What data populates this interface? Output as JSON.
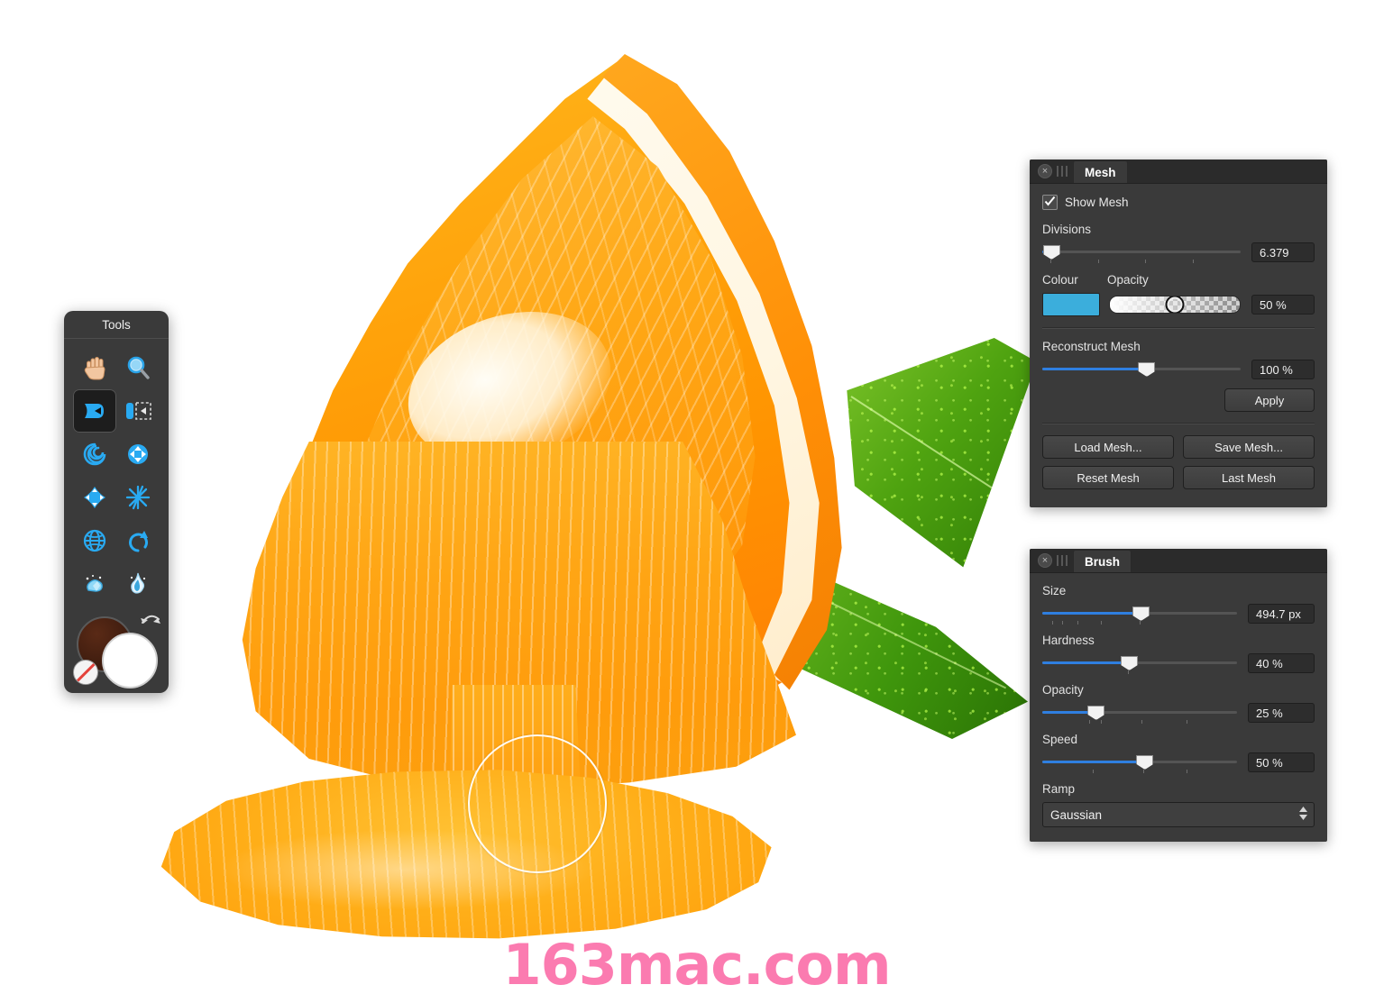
{
  "app": {
    "watermark": "163mac.com",
    "watermark_color": "#fb7bb0"
  },
  "tools_palette": {
    "title": "Tools",
    "selected_tool": "warp",
    "items": [
      {
        "name": "hand-tool",
        "icon": "hand-icon",
        "label": "Hand"
      },
      {
        "name": "zoom-tool",
        "icon": "magnifier-icon",
        "label": "Zoom"
      },
      {
        "name": "warp-tool",
        "icon": "warp-icon",
        "label": "Warp",
        "selected": true
      },
      {
        "name": "push-left-tool",
        "icon": "push-left-icon",
        "label": "Push Left"
      },
      {
        "name": "twirl-tool",
        "icon": "twirl-icon",
        "label": "Twirl"
      },
      {
        "name": "pinch-punch-tool",
        "icon": "four-arrows-icon",
        "label": "Pinch / Punch"
      },
      {
        "name": "bloat-tool",
        "icon": "star-arrows-icon",
        "label": "Bloat"
      },
      {
        "name": "turbulence-tool",
        "icon": "burst-icon",
        "label": "Turbulence"
      },
      {
        "name": "mesh-clone-tool",
        "icon": "globe-icon",
        "label": "Mesh Clone"
      },
      {
        "name": "reconstruct-tool",
        "icon": "undo-arrow-icon",
        "label": "Reconstruct"
      },
      {
        "name": "freeze-tool",
        "icon": "freeze-icon",
        "label": "Freeze"
      },
      {
        "name": "thaw-tool",
        "icon": "thaw-flame-icon",
        "label": "Thaw"
      }
    ],
    "colors": {
      "background_swatch": "#3a1b10",
      "foreground_swatch": "#ffffff",
      "swap_icon": "swap-arrows-icon",
      "none_icon": "no-color-icon"
    }
  },
  "mesh_panel": {
    "tab_label": "Mesh",
    "close_icon": "close-icon",
    "grip_icon": "grip-icon",
    "show_mesh": {
      "label": "Show Mesh",
      "checked": true
    },
    "divisions": {
      "label": "Divisions",
      "value": "6.379",
      "percent": 4
    },
    "colour": {
      "label": "Colour",
      "value": "#3baedc"
    },
    "opacity": {
      "label": "Opacity",
      "value": "50 %",
      "percent": 50
    },
    "reconstruct": {
      "label": "Reconstruct Mesh",
      "value": "100 %",
      "percent": 52
    },
    "apply_label": "Apply",
    "buttons": [
      {
        "name": "load-mesh-button",
        "label": "Load Mesh..."
      },
      {
        "name": "save-mesh-button",
        "label": "Save Mesh..."
      },
      {
        "name": "reset-mesh-button",
        "label": "Reset Mesh"
      },
      {
        "name": "last-mesh-button",
        "label": "Last Mesh"
      }
    ]
  },
  "brush_panel": {
    "tab_label": "Brush",
    "close_icon": "close-icon",
    "grip_icon": "grip-icon",
    "sliders": [
      {
        "name": "size",
        "label": "Size",
        "value": "494.7 px",
        "percent": 50
      },
      {
        "name": "hardness",
        "label": "Hardness",
        "value": "40 %",
        "percent": 44
      },
      {
        "name": "opacity",
        "label": "Opacity",
        "value": "25 %",
        "percent": 27
      },
      {
        "name": "speed",
        "label": "Speed",
        "value": "50 %",
        "percent": 52
      }
    ],
    "ramp": {
      "label": "Ramp",
      "value": "Gaussian",
      "arrows_icon": "stepper-arrows-icon"
    }
  }
}
